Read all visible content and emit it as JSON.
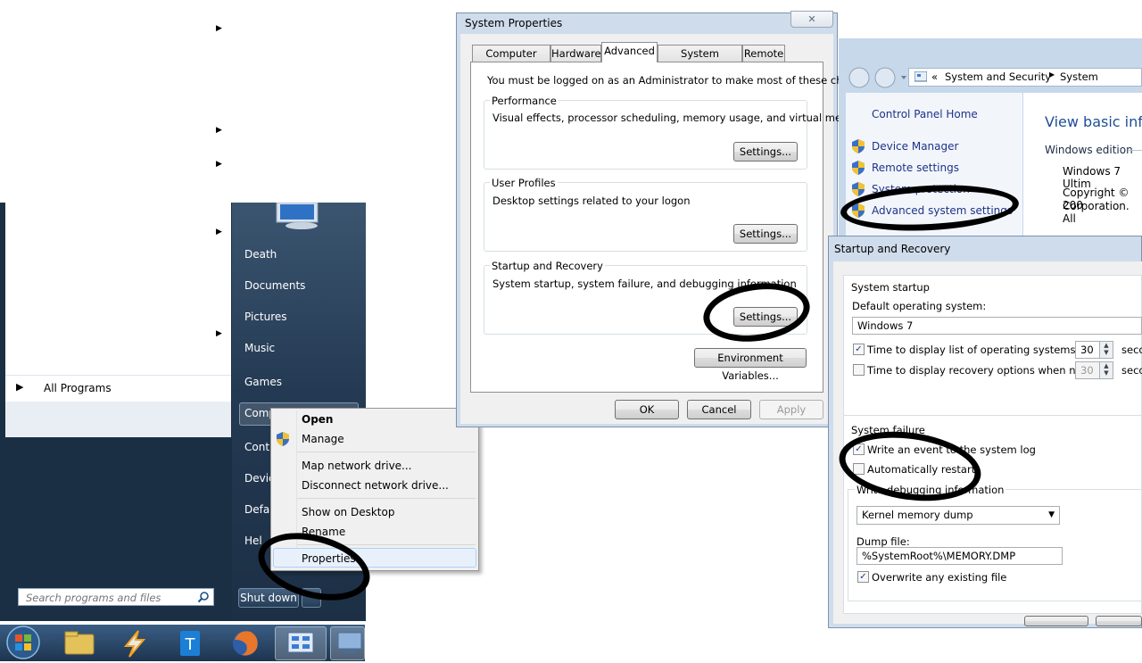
{
  "start_menu": {
    "right_items": [
      "Death",
      "Documents",
      "Pictures",
      "Music",
      "Games",
      "Comp",
      "Contr",
      "Devic",
      "Defau",
      "Hel"
    ],
    "all_programs": "All Programs",
    "search_placeholder": "Search programs and files",
    "shutdown_label": "Shut down"
  },
  "context_menu": {
    "items": [
      "Open",
      "Manage",
      "Map network drive...",
      "Disconnect network drive...",
      "Show on Desktop",
      "Rename",
      "Properties"
    ]
  },
  "system_properties": {
    "title": "System Properties",
    "tabs": [
      "Computer Name",
      "Hardware",
      "Advanced",
      "System Protection",
      "Remote"
    ],
    "admin_note": "You must be logged on as an Administrator to make most of these changes.",
    "performance": {
      "title": "Performance",
      "desc": "Visual effects, processor scheduling, memory usage, and virtual memory",
      "button": "Settings..."
    },
    "user_profiles": {
      "title": "User Profiles",
      "desc": "Desktop settings related to your logon",
      "button": "Settings..."
    },
    "startup_recovery": {
      "title": "Startup and Recovery",
      "desc": "System startup, system failure, and debugging information",
      "button": "Settings..."
    },
    "env_button": "Environment Variables...",
    "ok": "OK",
    "cancel": "Cancel",
    "apply": "Apply"
  },
  "control_panel": {
    "breadcrumb_root": "«",
    "breadcrumb": [
      "System and Security",
      "System"
    ],
    "home_link": "Control Panel Home",
    "links": [
      "Device Manager",
      "Remote settings",
      "System protection",
      "Advanced system settings"
    ],
    "heading": "View basic infor",
    "edition_label": "Windows edition",
    "edition_value": "Windows 7 Ultim",
    "copyright_line1": "Copyright © 200",
    "copyright_line2": "Corporation.  All"
  },
  "startup_recovery_dialog": {
    "title": "Startup and Recovery",
    "system_startup": "System startup",
    "default_os_label": "Default operating system:",
    "default_os_value": "Windows 7",
    "time_list_label": "Time to display list of operating systems:",
    "time_list_value": "30",
    "time_list_unit": "seco",
    "time_recovery_label": "Time to display recovery options when needed:",
    "time_recovery_value": "30",
    "time_recovery_unit": "seco",
    "system_failure": "System failure",
    "write_event_label": "Write an event to the system log",
    "auto_restart_label": "Automatically restart",
    "debug_info_label": "Write debugging information",
    "debug_select_value": "Kernel memory dump",
    "dump_file_label": "Dump file:",
    "dump_file_value": "%SystemRoot%\\MEMORY.DMP",
    "overwrite_label": "Overwrite any existing file"
  }
}
